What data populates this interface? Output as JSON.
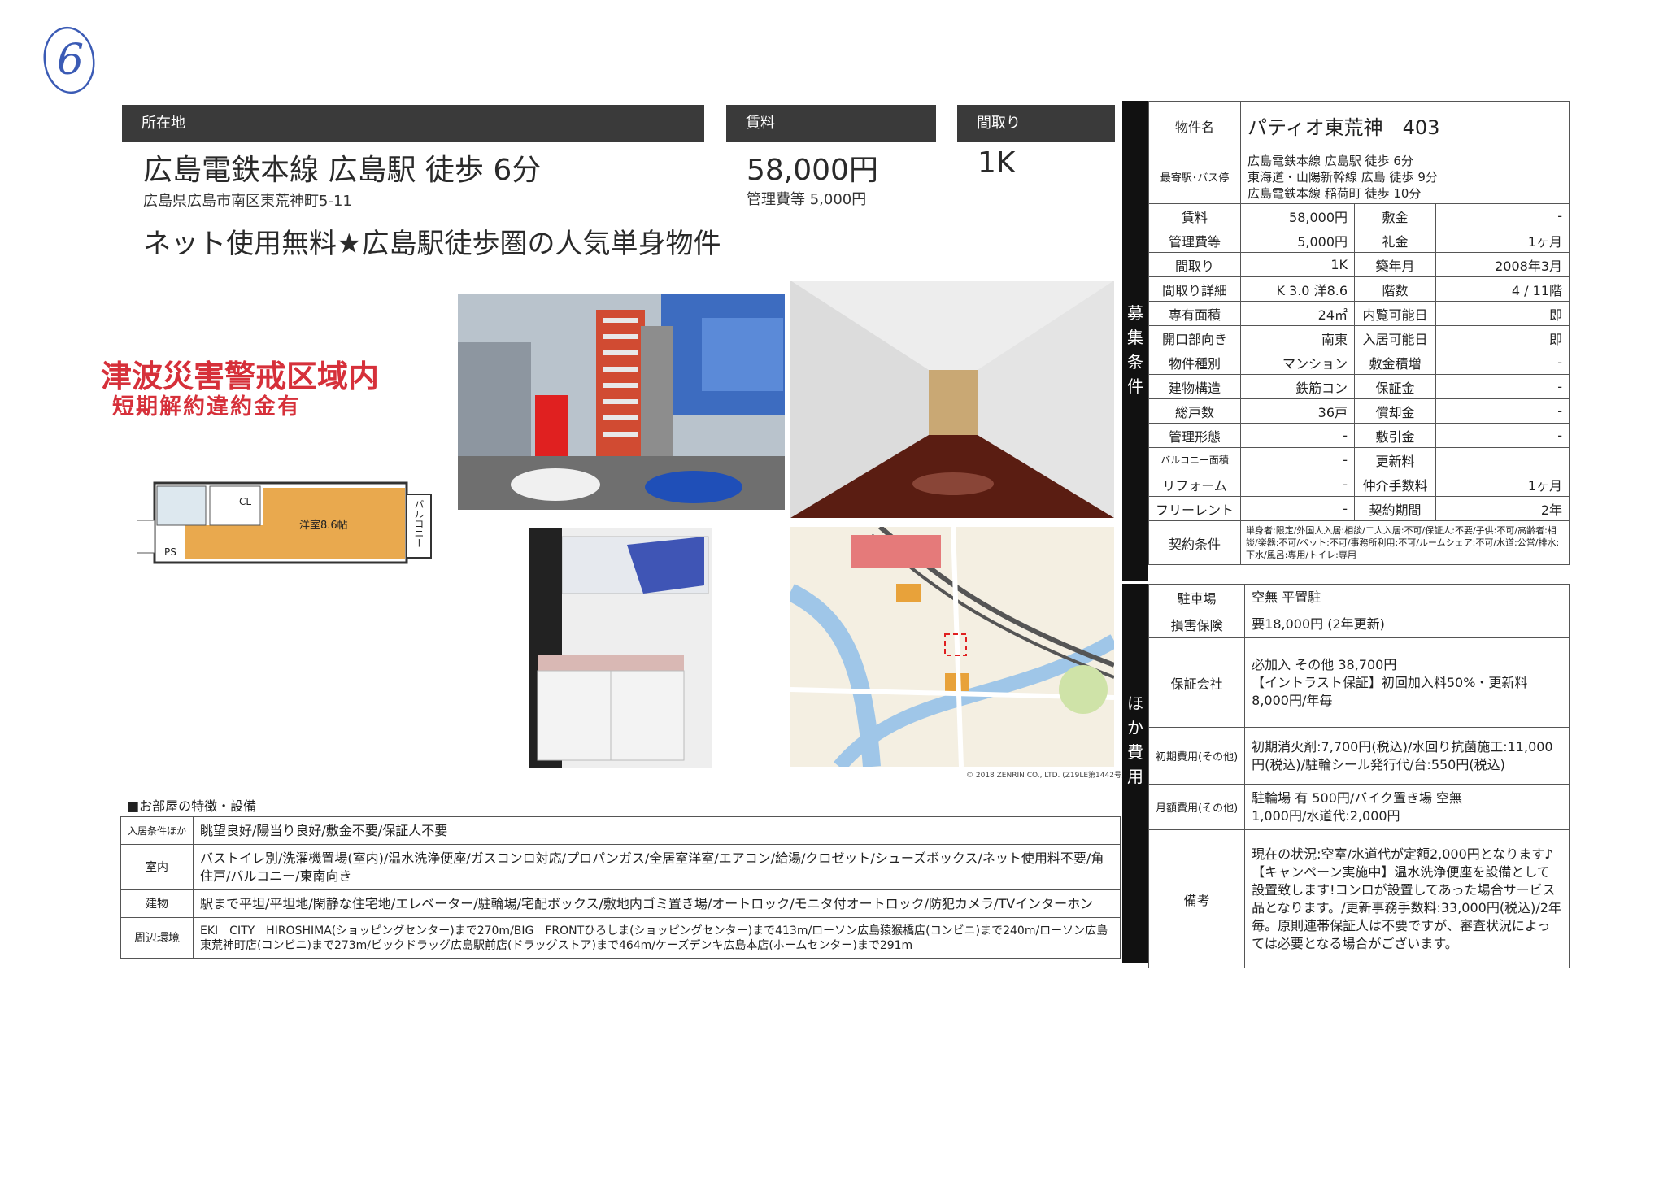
{
  "handwritten_number": "6",
  "header": {
    "location_label": "所在地",
    "rent_label": "賃料",
    "layout_label": "間取り"
  },
  "main": {
    "station": "広島電鉄本線 広島駅 徒歩 6分",
    "address": "広島県広島市南区東荒神町5-11",
    "rent": "58,000円",
    "mgmt_fee": "管理費等 5,000円",
    "layout": "1K",
    "catchphrase": "ネット使用無料★広島駅徒歩圏の人気単身物件"
  },
  "stamp": {
    "line1": "津波災害警戒区域内",
    "line2": "短期解約違約金有"
  },
  "floorplan": {
    "room_label": "洋室8.6帖",
    "balcony_label": "バルコニー",
    "cl_label": "CL",
    "ps_label": "PS"
  },
  "map_credit": "© 2018 ZENRIN CO., LTD. (Z19LE第1442号)",
  "spec": {
    "property_name_label": "物件名",
    "property_name": "パティオ東荒神　403",
    "nearest_label": "最寄駅･バス停",
    "nearest": [
      "広島電鉄本線 広島駅 徒歩 6分",
      "東海道・山陽新幹線 広島 徒歩 9分",
      "広島電鉄本線 稲荷町 徒歩 10分"
    ],
    "section_label": [
      "募",
      "集",
      "条",
      "件"
    ],
    "rows": [
      {
        "k1": "賃料",
        "v1": "58,000円",
        "k2": "敷金",
        "v2": "-"
      },
      {
        "k1": "管理費等",
        "v1": "5,000円",
        "k2": "礼金",
        "v2": "1ヶ月"
      },
      {
        "k1": "間取り",
        "v1": "1K",
        "k2": "築年月",
        "v2": "2008年3月"
      },
      {
        "k1": "間取り詳細",
        "v1": "K 3.0 洋8.6",
        "k2": "階数",
        "v2": "4 / 11階"
      },
      {
        "k1": "専有面積",
        "v1": "24㎡",
        "k2": "内覧可能日",
        "v2": "即"
      },
      {
        "k1": "開口部向き",
        "v1": "南東",
        "k2": "入居可能日",
        "v2": "即"
      },
      {
        "k1": "物件種別",
        "v1": "マンション",
        "k2": "敷金積増",
        "v2": "-"
      },
      {
        "k1": "建物構造",
        "v1": "鉄筋コン",
        "k2": "保証金",
        "v2": "-"
      },
      {
        "k1": "総戸数",
        "v1": "36戸",
        "k2": "償却金",
        "v2": "-"
      },
      {
        "k1": "管理形態",
        "v1": "-",
        "k2": "敷引金",
        "v2": "-"
      },
      {
        "k1": "バルコニー面積",
        "v1": "-",
        "k2": "更新料",
        "v2": ""
      },
      {
        "k1": "リフォーム",
        "v1": "-",
        "k2": "仲介手数料",
        "v2": "1ヶ月"
      },
      {
        "k1": "フリーレント",
        "v1": "-",
        "k2": "契約期間",
        "v2": "2年"
      }
    ],
    "contract_label": "契約条件",
    "contract": "単身者:限定/外国人入居:相談/二人入居:不可/保証人:不要/子供:不可/高齢者:相談/楽器:不可/ペット:不可/事務所利用:不可/ルームシェア:不可/水道:公営/排水:下水/風呂:専用/トイレ:専用"
  },
  "cost": {
    "section_label": [
      "ほ",
      "か",
      "費",
      "用"
    ],
    "rows": [
      {
        "k": "駐車場",
        "v": "空無 平置駐"
      },
      {
        "k": "損害保険",
        "v": "要18,000円 (2年更新)"
      },
      {
        "k": "保証会社",
        "v": "必加入 その他 38,700円\n【イントラスト保証】初回加入料50%・更新料8,000円/年毎"
      },
      {
        "k": "初期費用(その他)",
        "v": "初期消火剤:7,700円(税込)/水回り抗菌施工:11,000円(税込)/駐輪シール発行代/台:550円(税込)"
      },
      {
        "k": "月額費用(その他)",
        "v": "駐輪場 有 500円/バイク置き場 空無\n1,000円/水道代:2,000円"
      },
      {
        "k": "備考",
        "v": "現在の状況:空室/水道代が定額2,000円となります♪【キャンペーン実施中】温水洗浄便座を設備として設置致します!コンロが設置してあった場合サービス品となります。/更新事務手数料:33,000円(税込)/2年毎。原則連帯保証人は不要ですが、審査状況によっては必要となる場合がございます。"
      }
    ]
  },
  "features": {
    "heading": "■お部屋の特徴・設備",
    "rows": [
      {
        "k": "入居条件ほか",
        "v": "眺望良好/陽当り良好/敷金不要/保証人不要"
      },
      {
        "k": "室内",
        "v": "バストイレ別/洗濯機置場(室内)/温水洗浄便座/ガスコンロ対応/プロパンガス/全居室洋室/エアコン/給湯/クロゼット/シューズボックス/ネット使用料不要/角住戸/バルコニー/東南向き"
      },
      {
        "k": "建物",
        "v": "駅まで平坦/平坦地/閑静な住宅地/エレベーター/駐輪場/宅配ボックス/敷地内ゴミ置き場/オートロック/モニタ付オートロック/防犯カメラ/TVインターホン"
      },
      {
        "k": "周辺環境",
        "v": "EKI　CITY　HIROSHIMA(ショッピングセンター)まで270m/BIG　FRONTひろしま(ショッピングセンター)まで413m/ローソン広島猿猴橋店(コンビニ)まで240m/ローソン広島東荒神町店(コンビニ)まで273m/ビックドラッグ広島駅前店(ドラッグストア)まで464m/ケーズデンキ広島本店(ホームセンター)まで291m"
      }
    ]
  },
  "colors": {
    "header_bg": "#3a3a3a",
    "stamp_red": "#d6303a",
    "sidebar_bg": "#111111"
  }
}
